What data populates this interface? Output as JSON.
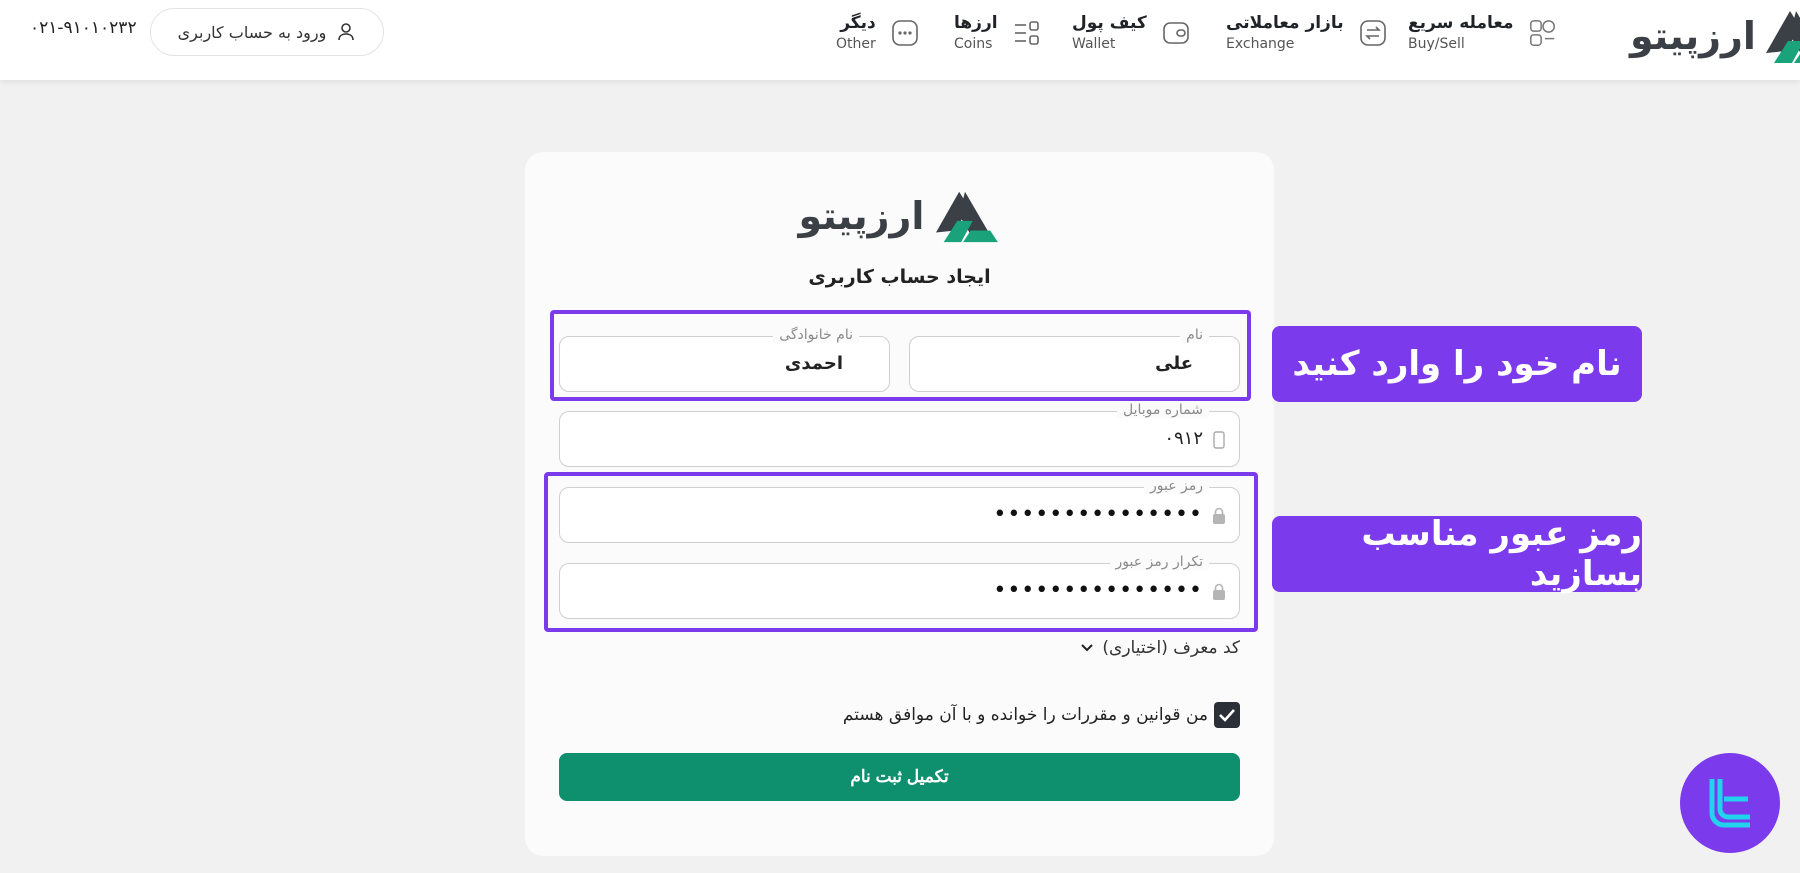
{
  "header": {
    "phone": "۰۲۱-۹۱۰۱۰۲۳۲",
    "login_label": "ورود به حساب کاربری",
    "brand_name": "ارزپیتو",
    "nav": [
      {
        "title": "معامله سریع",
        "sub": "Buy/Sell",
        "icon": "buy-sell-icon"
      },
      {
        "title": "بازار معاملاتی",
        "sub": "Exchange",
        "icon": "exchange-icon"
      },
      {
        "title": "کیف پول",
        "sub": "Wallet",
        "icon": "wallet-icon"
      },
      {
        "title": "ارزها",
        "sub": "Coins",
        "icon": "coins-icon"
      },
      {
        "title": "دیگر",
        "sub": "Other",
        "icon": "more-icon"
      }
    ]
  },
  "form": {
    "brand_name": "ارزپیتو",
    "title": "ایجاد حساب کاربری",
    "first_name_label": "نام",
    "first_name_value": "علی",
    "last_name_label": "نام خانوادگی",
    "last_name_value": "احمدی",
    "mobile_label": "شماره موبایل",
    "mobile_value": "۰۹۱۲",
    "password_label": "رمز عبور",
    "password_value": "•••••••••••••••",
    "password_confirm_label": "تکرار رمز عبور",
    "password_confirm_value": "•••••••••••••••",
    "referral_label": "کد معرف (اختیاری)",
    "terms_label": "من قوانین و مقررات را خوانده و با آن موافق هستم",
    "terms_checked": true,
    "submit_label": "تکمیل ثبت نام"
  },
  "annotations": {
    "name_callout": "نام خود را وارد کنید",
    "password_callout": "رمز عبور مناسب بسازید"
  },
  "colors": {
    "accent": "#0e8f6e",
    "highlight": "#7c3aed",
    "brand_green": "#1aa37a",
    "brand_dark": "#3b3f46"
  }
}
